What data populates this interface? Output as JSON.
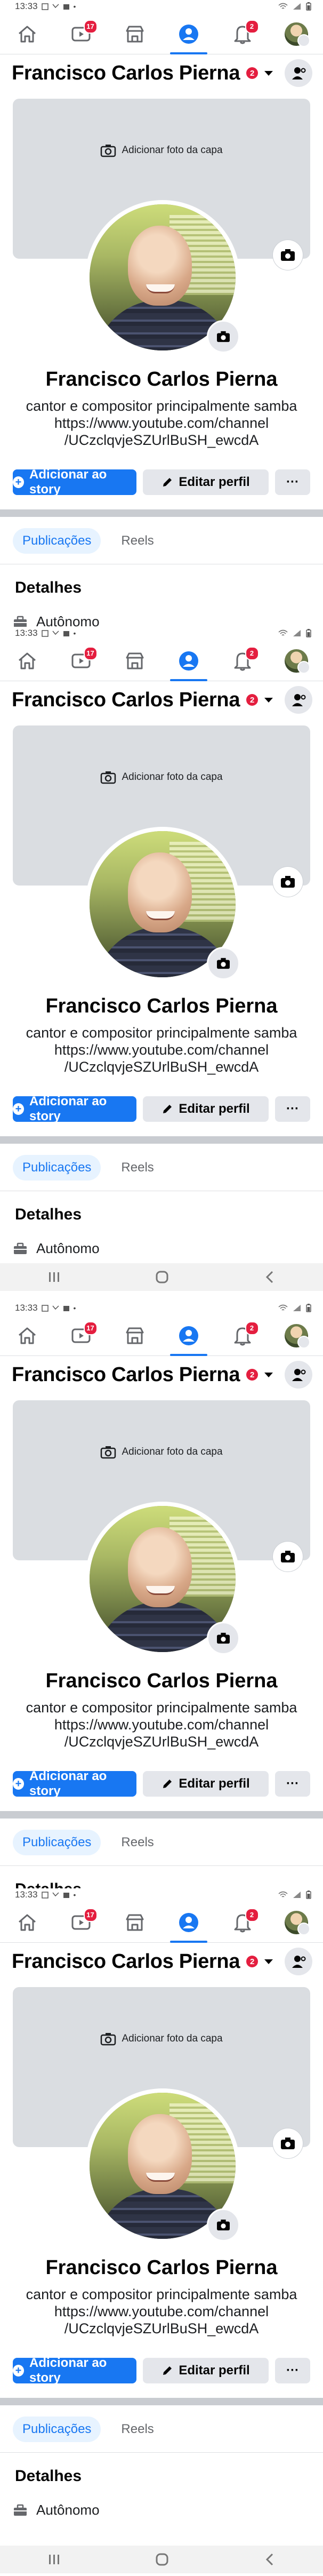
{
  "statusbar": {
    "time": "13:33"
  },
  "nav": {
    "items": [
      {
        "name": "home-icon",
        "badge": ""
      },
      {
        "name": "video-icon",
        "badge": "17"
      },
      {
        "name": "marketplace-icon",
        "badge": ""
      },
      {
        "name": "profile-icon",
        "badge": ""
      },
      {
        "name": "notifications-icon",
        "badge": "2"
      },
      {
        "name": "menu-avatar",
        "badge": ""
      }
    ]
  },
  "profile": {
    "header_name": "Francisco Carlos Pierna",
    "header_badge": "2",
    "cover_add_label": "Adicionar foto da capa",
    "name": "Francisco Carlos Pierna",
    "bio_line1": "cantor e compositor principalmente samba",
    "bio_line2": "https://www.youtube.com/channel",
    "bio_line3": "/UCzclqvjeSZUrlBuSH_ewcdA",
    "add_story_label": "Adicionar ao story",
    "edit_profile_label": "Editar perfil",
    "more_label": "···"
  },
  "tabs": [
    {
      "label": "Publicações",
      "active": true
    },
    {
      "label": "Reels",
      "active": false
    }
  ],
  "details": {
    "title": "Detalhes",
    "row_label": "Autônomo"
  },
  "colors": {
    "accent": "#1877f2",
    "badge": "#e41e3f",
    "cover": "#dadde1",
    "tab_active_bg": "#e7f3ff"
  }
}
